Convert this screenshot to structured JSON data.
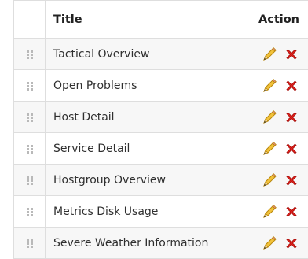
{
  "table": {
    "headers": {
      "handle": "",
      "title": "Title",
      "action": "Action"
    },
    "rows": [
      {
        "title": "Tactical Overview",
        "edit_icon": "pencil-icon",
        "delete_icon": "red-x-icon"
      },
      {
        "title": "Open Problems",
        "edit_icon": "pencil-icon",
        "delete_icon": "red-x-icon"
      },
      {
        "title": "Host Detail",
        "edit_icon": "pencil-icon",
        "delete_icon": "red-x-icon"
      },
      {
        "title": "Service Detail",
        "edit_icon": "pencil-icon",
        "delete_icon": "red-x-icon"
      },
      {
        "title": "Hostgroup Overview",
        "edit_icon": "pencil-icon",
        "delete_icon": "red-x-icon"
      },
      {
        "title": "Metrics Disk Usage",
        "edit_icon": "pencil-icon",
        "delete_icon": "red-x-icon"
      },
      {
        "title": "Severe Weather Information",
        "edit_icon": "pencil-icon",
        "delete_icon": "red-x-icon"
      }
    ]
  },
  "colors": {
    "row_alt": "#f7f7f7",
    "border": "#dedede",
    "delete_red": "#e0201c",
    "pencil_yellow": "#f2c23a"
  }
}
